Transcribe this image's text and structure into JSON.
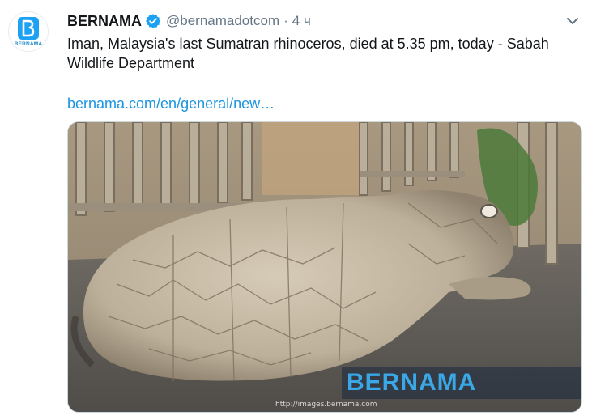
{
  "tweet": {
    "author": {
      "display_name": "BERNAMA",
      "handle": "@bernamadotcom",
      "avatar_label": "BERNAMA",
      "verified": true
    },
    "separator": "·",
    "timestamp": "4 ч",
    "text": "Iman, Malaysia's last Sumatran rhinoceros, died at 5.35 pm, today - Sabah Wildlife Department",
    "link_text": "bernama.com/en/general/new…",
    "media": {
      "watermark": "BERNAMA",
      "credit": "http://images.bernama.com"
    }
  },
  "colors": {
    "text": "#14171a",
    "secondary": "#657786",
    "link": "#1b95e0",
    "verified": "#1da1f2",
    "brand": "#1da1f2"
  },
  "icons": [
    "verified-badge-icon",
    "chevron-down-icon",
    "bernama-logo-icon"
  ]
}
